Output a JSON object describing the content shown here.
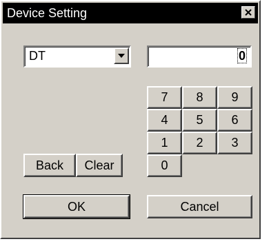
{
  "window": {
    "title": "Device Setting",
    "close_label": "×"
  },
  "device_select": {
    "selected": "DT"
  },
  "display": {
    "value": "0"
  },
  "keypad": {
    "k7": "7",
    "k8": "8",
    "k9": "9",
    "k4": "4",
    "k5": "5",
    "k6": "6",
    "k1": "1",
    "k2": "2",
    "k3": "3",
    "k0": "0"
  },
  "buttons": {
    "back": "Back",
    "clear": "Clear",
    "ok": "OK",
    "cancel": "Cancel"
  }
}
